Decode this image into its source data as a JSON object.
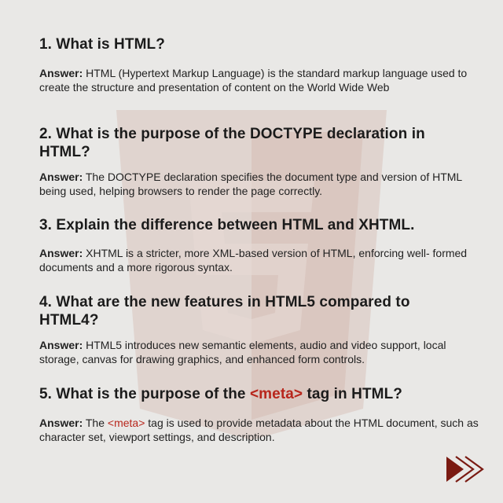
{
  "items": [
    {
      "question": "1. What is HTML?",
      "answer_label": "Answer:",
      "answer": " HTML (Hypertext Markup Language) is the standard markup language used to create the structure and presentation of content on the World Wide Web"
    },
    {
      "question": "2. What is the purpose of the DOCTYPE declaration in HTML?",
      "answer_label": "Answer:",
      "answer": " The DOCTYPE declaration specifies the document type and version of HTML being used, helping browsers to render the page correctly."
    },
    {
      "question": "3. Explain the difference between HTML and XHTML.",
      "answer_label": "Answer:",
      "answer": " XHTML is a stricter, more XML-based version of HTML, enforcing well- formed documents and a more rigorous syntax."
    },
    {
      "question": "4. What are the new features in HTML5 compared to HTML4?",
      "answer_label": "Answer:",
      "answer": " HTML5 introduces new semantic elements, audio and video support, local storage, canvas for drawing graphics, and enhanced form controls."
    },
    {
      "question_prefix": "5. What is the purpose of the ",
      "question_tag": "<meta>",
      "question_suffix": " tag in HTML?",
      "answer_label": "Answer:",
      "answer_prefix": " The ",
      "answer_tag": "<meta>",
      "answer_suffix": " tag is used to provide metadata about the HTML document, such as character set, viewport settings, and description."
    }
  ],
  "colors": {
    "background": "#e9e8e6",
    "accent": "#b8261c",
    "arrow": "#7a1a12",
    "watermark": "#dcc9c3"
  },
  "icons": {
    "watermark": "html5-logo-icon",
    "next": "triple-chevron-right-icon"
  }
}
